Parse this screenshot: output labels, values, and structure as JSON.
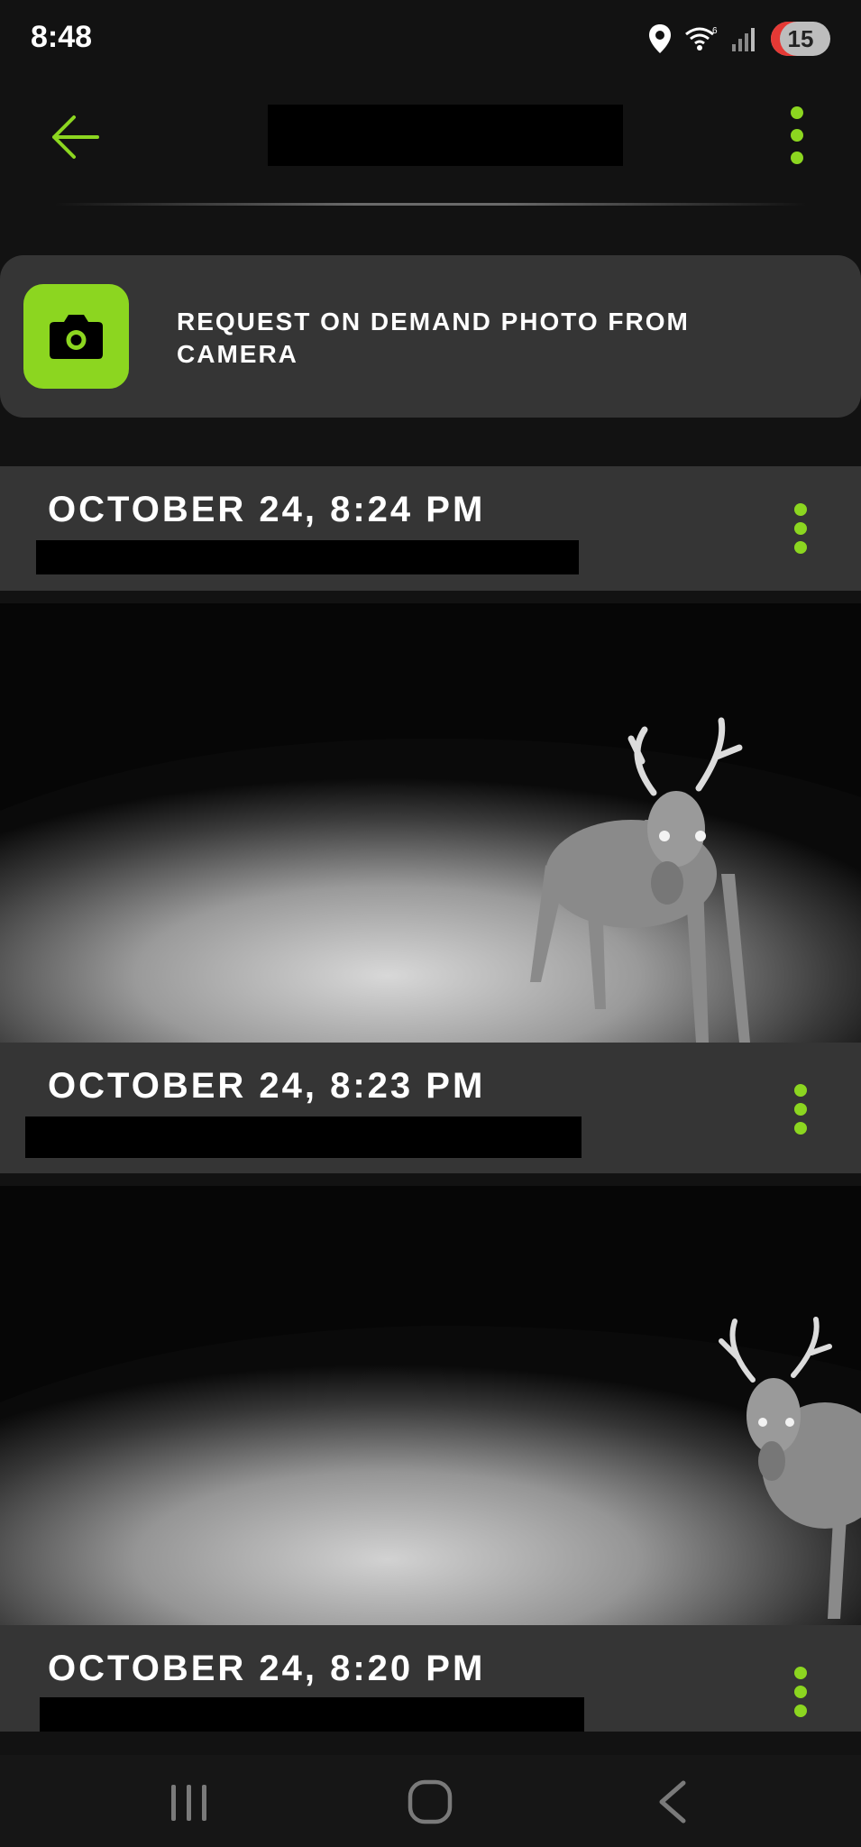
{
  "status_bar": {
    "time": "8:48",
    "notification_count": "15",
    "icons": [
      "location-icon",
      "wifi-icon",
      "signal-icon"
    ]
  },
  "header": {
    "back_icon": "arrow-left-icon",
    "menu_icon": "more-vertical-icon"
  },
  "request": {
    "label": "REQUEST ON DEMAND PHOTO FROM CAMERA",
    "icon": "camera-icon"
  },
  "photos": [
    {
      "date": "OCTOBER 24, 8:24 PM"
    },
    {
      "date": "OCTOBER 24, 8:23 PM"
    },
    {
      "date": "OCTOBER 24, 8:20 PM"
    }
  ],
  "nav": {
    "recents_icon": "recents-icon",
    "home_icon": "home-icon",
    "back_icon": "nav-back-icon"
  },
  "colors": {
    "accent": "#8cd620",
    "card": "#353535",
    "background": "#121212"
  }
}
